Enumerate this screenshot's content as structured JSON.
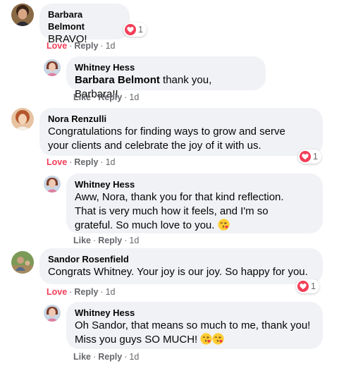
{
  "comments": [
    {
      "author": "Barbara Belmont",
      "text": "BRAVO!",
      "reaction_count": "1",
      "actions": {
        "love": "Love",
        "reply": "Reply",
        "time": "1d"
      },
      "reply": {
        "author": "Whitney Hess",
        "mention": "Barbara Belmont",
        "text": "thank you, Barbara!!",
        "actions": {
          "like": "Like",
          "reply": "Reply",
          "time": "1d"
        }
      }
    },
    {
      "author": "Nora Renzulli",
      "text_lines": [
        "Congratulations for finding ways to grow and serve",
        "your clients and celebrate the joy of it with us."
      ],
      "reaction_count": "1",
      "actions": {
        "love": "Love",
        "reply": "Reply",
        "time": "1d"
      },
      "reply": {
        "author": "Whitney Hess",
        "text_lines": [
          "Aww, Nora, thank you for that kind reflection.",
          "That is very much how it feels, and I'm so",
          "grateful. So much love to you."
        ],
        "actions": {
          "like": "Like",
          "reply": "Reply",
          "time": "1d"
        }
      }
    },
    {
      "author": "Sandor Rosenfield",
      "text": "Congrats Whitney. Your joy is our joy. So happy for you.",
      "reaction_count": "1",
      "actions": {
        "love": "Love",
        "reply": "Reply",
        "time": "1d"
      },
      "reply": {
        "author": "Whitney Hess",
        "text_lines": [
          "Oh Sandor, that means so much to me, thank you!",
          "Miss you guys SO MUCH!"
        ],
        "actions": {
          "like": "Like",
          "reply": "Reply",
          "time": "1d"
        }
      }
    }
  ],
  "icons": {
    "reaction": "love-heart-icon",
    "emoji": "face-blowing-kiss-icon"
  },
  "colors": {
    "love": "#f33e58",
    "bubble": "#f0f2f5",
    "meta": "#65676b"
  }
}
